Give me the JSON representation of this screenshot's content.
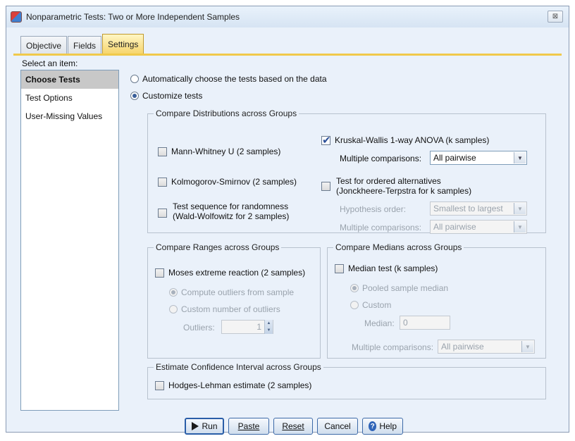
{
  "window": {
    "title": "Nonparametric Tests: Two or More Independent Samples",
    "close_glyph": "⊠"
  },
  "tabs": [
    {
      "label": "Objective"
    },
    {
      "label": "Fields"
    },
    {
      "label": "Settings"
    }
  ],
  "sidebar": {
    "heading": "Select an item:",
    "items": [
      {
        "label": "Choose Tests"
      },
      {
        "label": "Test Options"
      },
      {
        "label": "User-Missing Values"
      }
    ]
  },
  "mode": {
    "auto_label": "Automatically choose the tests based on the data",
    "custom_label": "Customize tests"
  },
  "distributions": {
    "title": "Compare Distributions across Groups",
    "mann_whitney": "Mann-Whitney U (2 samples)",
    "kolmogorov": "Kolmogorov-Smirnov (2 samples)",
    "runs_line1": "Test sequence for randomness",
    "runs_line2": "(Wald-Wolfowitz for 2 samples)",
    "kruskal": "Kruskal-Wallis 1-way ANOVA (k samples)",
    "multiple_label": "Multiple comparisons:",
    "multiple_value": "All pairwise",
    "ordered_line1": "Test for ordered alternatives",
    "ordered_line2": "(Jonckheere-Terpstra for k samples)",
    "hypothesis_label": "Hypothesis order:",
    "hypothesis_value": "Smallest to largest",
    "multiple2_label": "Multiple comparisons:",
    "multiple2_value": "All pairwise"
  },
  "ranges": {
    "title": "Compare Ranges across Groups",
    "moses": "Moses extreme reaction (2 samples)",
    "compute_outliers": "Compute outliers from sample",
    "custom_outliers": "Custom number of outliers",
    "outliers_label": "Outliers:",
    "outliers_value": "1"
  },
  "medians": {
    "title": "Compare Medians across Groups",
    "median_test": "Median test (k samples)",
    "pooled": "Pooled sample median",
    "custom": "Custom",
    "median_label": "Median:",
    "median_value": "0",
    "multiple_label": "Multiple comparisons:",
    "multiple_value": "All pairwise"
  },
  "confidence": {
    "title": "Estimate Confidence Interval across Groups",
    "hodges": "Hodges-Lehman estimate (2 samples)"
  },
  "buttons": {
    "run": "Run",
    "paste": "Paste",
    "reset": "Reset",
    "cancel": "Cancel",
    "help": "Help"
  },
  "glyphs": {
    "checkmark": "✔",
    "dropdown": "▼",
    "up": "▲",
    "down": "▼",
    "help": "?"
  }
}
